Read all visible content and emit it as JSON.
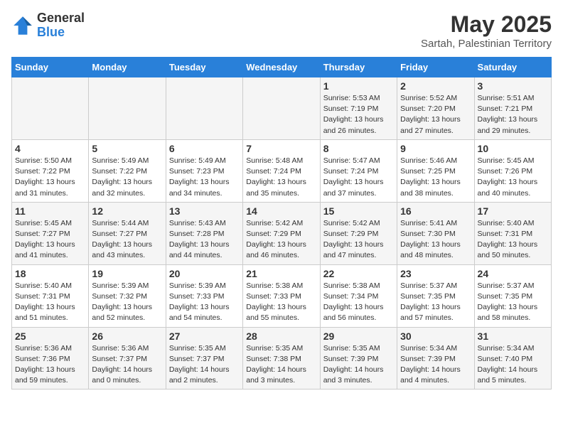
{
  "header": {
    "logo_general": "General",
    "logo_blue": "Blue",
    "month_year": "May 2025",
    "subtitle": "Sartah, Palestinian Territory"
  },
  "weekdays": [
    "Sunday",
    "Monday",
    "Tuesday",
    "Wednesday",
    "Thursday",
    "Friday",
    "Saturday"
  ],
  "weeks": [
    [
      {
        "day": "",
        "info": ""
      },
      {
        "day": "",
        "info": ""
      },
      {
        "day": "",
        "info": ""
      },
      {
        "day": "",
        "info": ""
      },
      {
        "day": "1",
        "info": "Sunrise: 5:53 AM\nSunset: 7:19 PM\nDaylight: 13 hours\nand 26 minutes."
      },
      {
        "day": "2",
        "info": "Sunrise: 5:52 AM\nSunset: 7:20 PM\nDaylight: 13 hours\nand 27 minutes."
      },
      {
        "day": "3",
        "info": "Sunrise: 5:51 AM\nSunset: 7:21 PM\nDaylight: 13 hours\nand 29 minutes."
      }
    ],
    [
      {
        "day": "4",
        "info": "Sunrise: 5:50 AM\nSunset: 7:22 PM\nDaylight: 13 hours\nand 31 minutes."
      },
      {
        "day": "5",
        "info": "Sunrise: 5:49 AM\nSunset: 7:22 PM\nDaylight: 13 hours\nand 32 minutes."
      },
      {
        "day": "6",
        "info": "Sunrise: 5:49 AM\nSunset: 7:23 PM\nDaylight: 13 hours\nand 34 minutes."
      },
      {
        "day": "7",
        "info": "Sunrise: 5:48 AM\nSunset: 7:24 PM\nDaylight: 13 hours\nand 35 minutes."
      },
      {
        "day": "8",
        "info": "Sunrise: 5:47 AM\nSunset: 7:24 PM\nDaylight: 13 hours\nand 37 minutes."
      },
      {
        "day": "9",
        "info": "Sunrise: 5:46 AM\nSunset: 7:25 PM\nDaylight: 13 hours\nand 38 minutes."
      },
      {
        "day": "10",
        "info": "Sunrise: 5:45 AM\nSunset: 7:26 PM\nDaylight: 13 hours\nand 40 minutes."
      }
    ],
    [
      {
        "day": "11",
        "info": "Sunrise: 5:45 AM\nSunset: 7:27 PM\nDaylight: 13 hours\nand 41 minutes."
      },
      {
        "day": "12",
        "info": "Sunrise: 5:44 AM\nSunset: 7:27 PM\nDaylight: 13 hours\nand 43 minutes."
      },
      {
        "day": "13",
        "info": "Sunrise: 5:43 AM\nSunset: 7:28 PM\nDaylight: 13 hours\nand 44 minutes."
      },
      {
        "day": "14",
        "info": "Sunrise: 5:42 AM\nSunset: 7:29 PM\nDaylight: 13 hours\nand 46 minutes."
      },
      {
        "day": "15",
        "info": "Sunrise: 5:42 AM\nSunset: 7:29 PM\nDaylight: 13 hours\nand 47 minutes."
      },
      {
        "day": "16",
        "info": "Sunrise: 5:41 AM\nSunset: 7:30 PM\nDaylight: 13 hours\nand 48 minutes."
      },
      {
        "day": "17",
        "info": "Sunrise: 5:40 AM\nSunset: 7:31 PM\nDaylight: 13 hours\nand 50 minutes."
      }
    ],
    [
      {
        "day": "18",
        "info": "Sunrise: 5:40 AM\nSunset: 7:31 PM\nDaylight: 13 hours\nand 51 minutes."
      },
      {
        "day": "19",
        "info": "Sunrise: 5:39 AM\nSunset: 7:32 PM\nDaylight: 13 hours\nand 52 minutes."
      },
      {
        "day": "20",
        "info": "Sunrise: 5:39 AM\nSunset: 7:33 PM\nDaylight: 13 hours\nand 54 minutes."
      },
      {
        "day": "21",
        "info": "Sunrise: 5:38 AM\nSunset: 7:33 PM\nDaylight: 13 hours\nand 55 minutes."
      },
      {
        "day": "22",
        "info": "Sunrise: 5:38 AM\nSunset: 7:34 PM\nDaylight: 13 hours\nand 56 minutes."
      },
      {
        "day": "23",
        "info": "Sunrise: 5:37 AM\nSunset: 7:35 PM\nDaylight: 13 hours\nand 57 minutes."
      },
      {
        "day": "24",
        "info": "Sunrise: 5:37 AM\nSunset: 7:35 PM\nDaylight: 13 hours\nand 58 minutes."
      }
    ],
    [
      {
        "day": "25",
        "info": "Sunrise: 5:36 AM\nSunset: 7:36 PM\nDaylight: 13 hours\nand 59 minutes."
      },
      {
        "day": "26",
        "info": "Sunrise: 5:36 AM\nSunset: 7:37 PM\nDaylight: 14 hours\nand 0 minutes."
      },
      {
        "day": "27",
        "info": "Sunrise: 5:35 AM\nSunset: 7:37 PM\nDaylight: 14 hours\nand 2 minutes."
      },
      {
        "day": "28",
        "info": "Sunrise: 5:35 AM\nSunset: 7:38 PM\nDaylight: 14 hours\nand 3 minutes."
      },
      {
        "day": "29",
        "info": "Sunrise: 5:35 AM\nSunset: 7:39 PM\nDaylight: 14 hours\nand 3 minutes."
      },
      {
        "day": "30",
        "info": "Sunrise: 5:34 AM\nSunset: 7:39 PM\nDaylight: 14 hours\nand 4 minutes."
      },
      {
        "day": "31",
        "info": "Sunrise: 5:34 AM\nSunset: 7:40 PM\nDaylight: 14 hours\nand 5 minutes."
      }
    ]
  ]
}
